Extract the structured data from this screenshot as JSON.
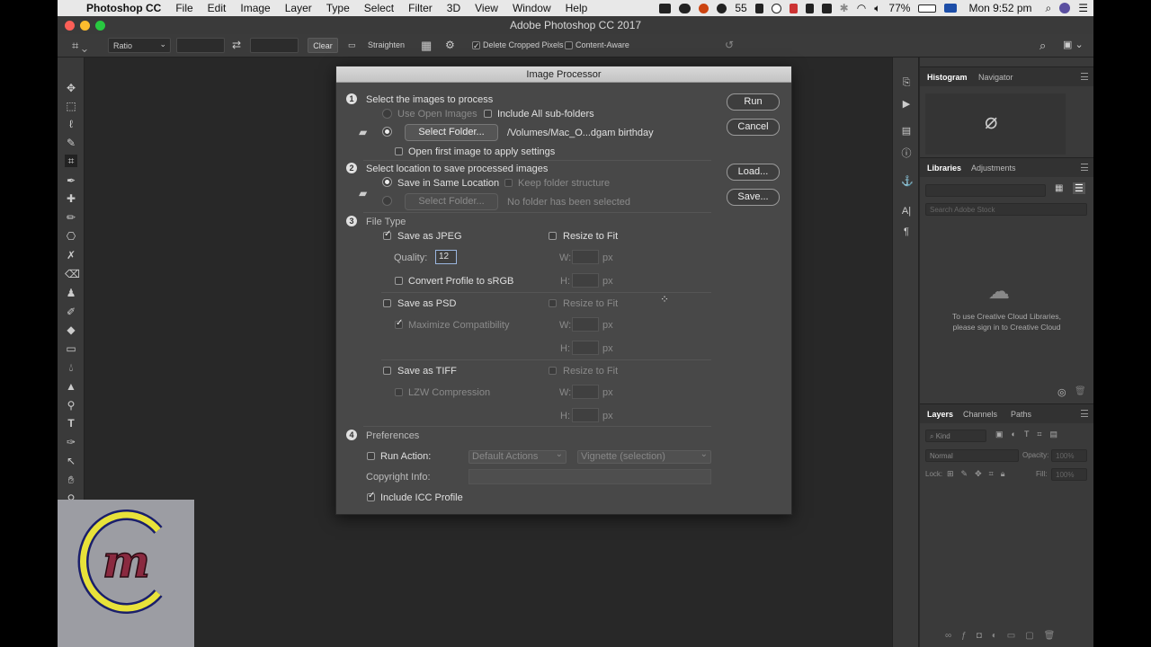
{
  "menubar": {
    "apple": "",
    "items": [
      "Photoshop CC",
      "File",
      "Edit",
      "Image",
      "Layer",
      "Type",
      "Select",
      "Filter",
      "3D",
      "View",
      "Window",
      "Help"
    ],
    "notifications": "55",
    "battery": "77%",
    "clock": "Mon 9:52 pm"
  },
  "window": {
    "title": "Adobe Photoshop CC 2017"
  },
  "options_bar": {
    "ratio": "Ratio",
    "clear": "Clear",
    "straighten": "Straighten",
    "delete_cropped": "Delete Cropped Pixels",
    "content_aware": "Content-Aware"
  },
  "dialog": {
    "title": "Image Processor",
    "s1": {
      "num": "1",
      "title": "Select the images to process",
      "use_open": "Use Open Images",
      "include_sub": "Include All sub-folders",
      "select_folder": "Select Folder...",
      "path": "/Volumes/Mac_O...dgam birthday",
      "open_first": "Open first image to apply settings"
    },
    "s2": {
      "num": "2",
      "title": "Select location to save processed images",
      "same_loc": "Save in Same Location",
      "keep_struct": "Keep folder structure",
      "select_folder": "Select Folder...",
      "no_folder": "No folder has been selected"
    },
    "s3": {
      "num": "3",
      "title": "File Type",
      "jpeg": "Save as JPEG",
      "resize": "Resize to Fit",
      "quality_label": "Quality:",
      "quality_value": "12",
      "convert": "Convert Profile to sRGB",
      "psd": "Save as PSD",
      "maximize": "Maximize Compatibility",
      "tiff": "Save as TIFF",
      "lzw": "LZW Compression",
      "w": "W:",
      "h": "H:",
      "px": "px"
    },
    "s4": {
      "num": "4",
      "title": "Preferences",
      "run_action": "Run Action:",
      "action_set": "Default Actions",
      "action": "Vignette (selection)",
      "copyright": "Copyright Info:",
      "icc": "Include ICC Profile"
    },
    "buttons": {
      "run": "Run",
      "cancel": "Cancel",
      "load": "Load...",
      "save": "Save..."
    }
  },
  "panels": {
    "top_tabs": [
      "Histogram",
      "Navigator"
    ],
    "lib_tabs": [
      "Libraries",
      "Adjustments"
    ],
    "search_placeholder": "Search Adobe Stock",
    "cc_message_1": "To use Creative Cloud Libraries,",
    "cc_message_2": "please sign in to Creative Cloud",
    "layer_tabs": [
      "Layers",
      "Channels",
      "Paths"
    ],
    "kind": "Kind",
    "blend": "Normal",
    "opacity_label": "Opacity:",
    "opacity_value": "100%",
    "lock_label": "Lock:",
    "fill_label": "Fill:",
    "fill_value": "100%"
  },
  "logo": {
    "text": "m"
  }
}
